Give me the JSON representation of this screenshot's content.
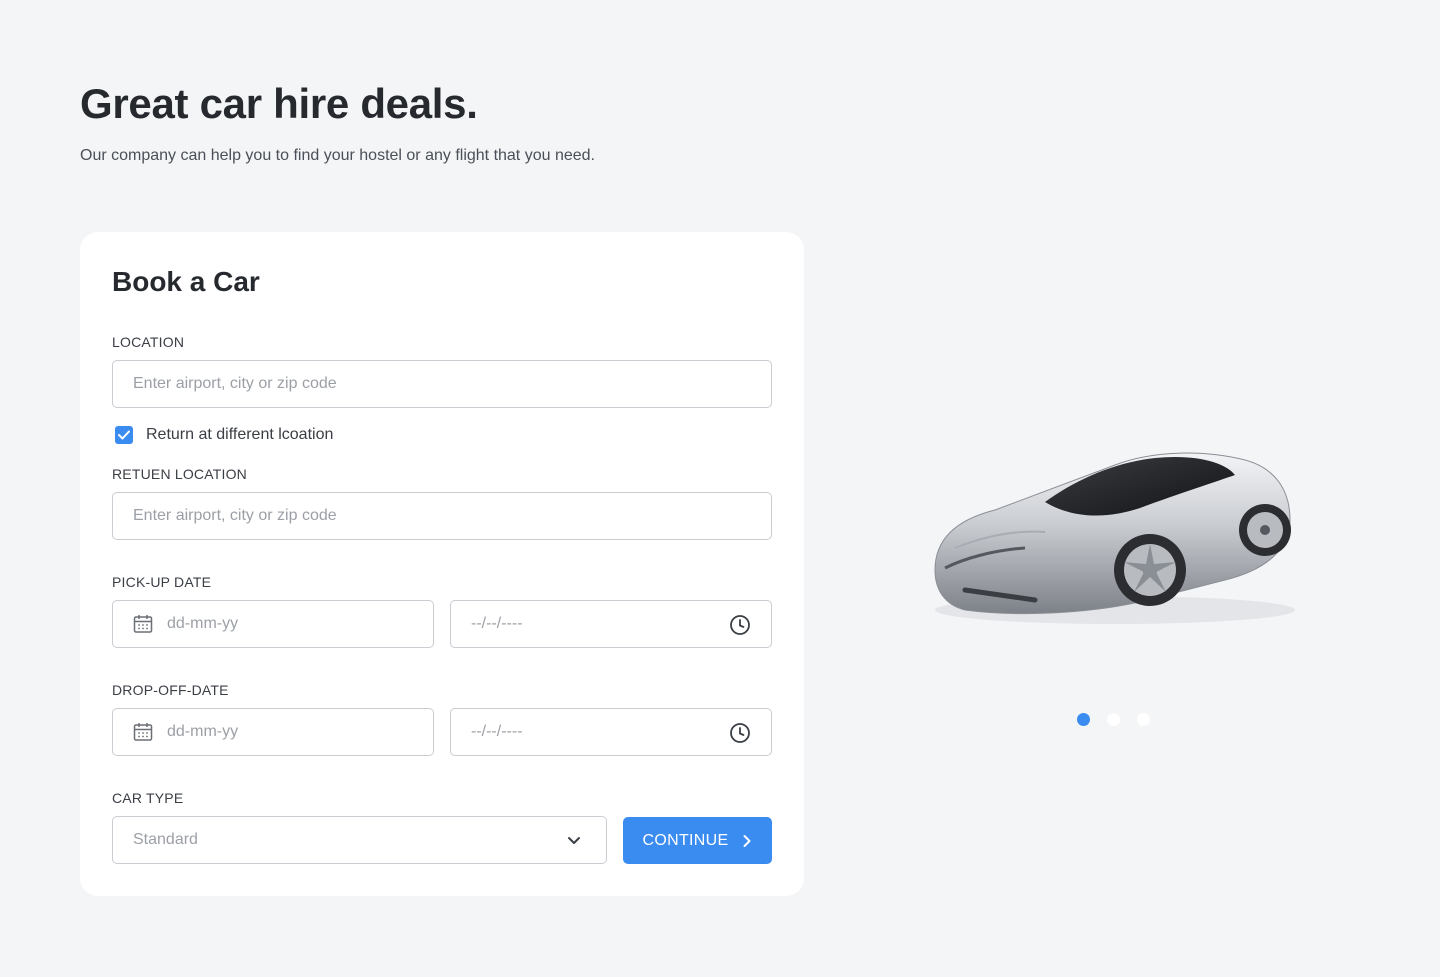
{
  "hero": {
    "title": "Great car hire deals.",
    "subtitle": "Our company can help you to find your hostel or any flight that you need."
  },
  "form": {
    "title": "Book a Car",
    "location": {
      "label": "LOCATION",
      "placeholder": "Enter airport, city or zip code",
      "value": ""
    },
    "return_checkbox": {
      "label": "Return at different lcoation",
      "checked": true
    },
    "return_location": {
      "label": "RETUEN LOCATION",
      "placeholder": "Enter airport, city or zip code",
      "value": ""
    },
    "pickup": {
      "label": "PICK-UP DATE",
      "date_placeholder": "dd-mm-yy",
      "time_placeholder": "--/--/----"
    },
    "dropoff": {
      "label": "DROP-OFF-DATE",
      "date_placeholder": "dd-mm-yy",
      "time_placeholder": "--/--/----"
    },
    "car_type": {
      "label": "CAR TYPE",
      "selected": "Standard"
    },
    "continue_label": "CONTINUE"
  },
  "carousel": {
    "image": "sports-car-silver",
    "slides": 3,
    "active_index": 0
  },
  "colors": {
    "accent": "#3b8cf0",
    "background": "#f4f5f7",
    "card": "#ffffff",
    "text": "#26292e"
  }
}
